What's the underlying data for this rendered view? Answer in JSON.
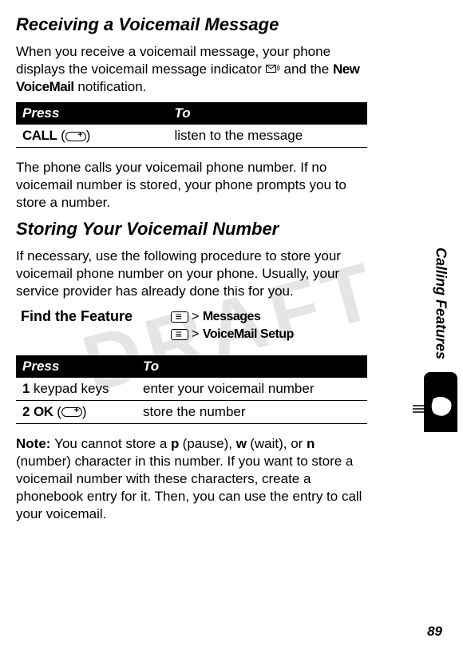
{
  "watermark": "DRAFT",
  "section1": {
    "title": "Receiving a Voicemail Message",
    "para1_a": "When you receive a voicemail message, your phone displays the voicemail message indicator ",
    "para1_b": " and the ",
    "new_vm": "New VoiceMail",
    "para1_c": " notification.",
    "table": {
      "h1": "Press",
      "h2": "To",
      "r1_press": "CALL",
      "r1_to": "listen to the message"
    },
    "para2": "The phone calls your voicemail phone number. If no voicemail number is stored, your phone prompts you to store a number."
  },
  "section2": {
    "title": "Storing Your Voicemail Number",
    "para1": "If necessary, use the following procedure to store your voicemail phone number on your phone. Usually, your service provider has already done this for you.",
    "feature_label": "Find the Feature",
    "path1": "Messages",
    "path2": "VoiceMail Setup",
    "table": {
      "h1": "Press",
      "h2": "To",
      "r1_num": "1",
      "r1_press": "keypad keys",
      "r1_to": "enter your voicemail number",
      "r2_num": "2",
      "r2_press": "OK",
      "r2_to": "store the number"
    },
    "note_label": "Note: ",
    "note_a": "You cannot store a ",
    "note_p": "p",
    "note_b": " (pause), ",
    "note_w": "w",
    "note_c": " (wait), or ",
    "note_n": "n",
    "note_d": " (number) character in this number. If you want to store a voicemail number with these characters, create a phonebook entry for it. Then, you can use the entry to call your voicemail."
  },
  "side_label": "Calling Features",
  "page_number": "89",
  "gt": ">"
}
